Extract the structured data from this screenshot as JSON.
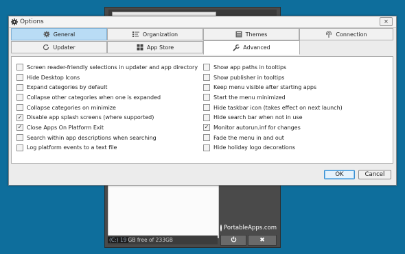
{
  "dialog": {
    "title": "Options",
    "close_label": "✕",
    "tabs": [
      {
        "label": "General",
        "icon": "gear-icon",
        "state": "highlighted"
      },
      {
        "label": "Organization",
        "icon": "list-icon",
        "state": "normal"
      },
      {
        "label": "Themes",
        "icon": "themes-icon",
        "state": "normal"
      },
      {
        "label": "Connection",
        "icon": "antenna-icon",
        "state": "normal"
      },
      {
        "label": "Updater",
        "icon": "refresh-icon",
        "state": "normal"
      },
      {
        "label": "App Store",
        "icon": "grid-icon",
        "state": "normal"
      },
      {
        "label": "Advanced",
        "icon": "wrench-icon",
        "state": "active"
      }
    ],
    "left_options": [
      {
        "label": "Screen reader-friendly selections in updater and app directory",
        "checked": false
      },
      {
        "label": "Hide Desktop Icons",
        "checked": false
      },
      {
        "label": "Expand categories by default",
        "checked": false
      },
      {
        "label": "Collapse other categories when one is expanded",
        "checked": false
      },
      {
        "label": "Collapse categories on minimize",
        "checked": false
      },
      {
        "label": "Disable app splash screens (where supported)",
        "checked": true
      },
      {
        "label": "Close Apps On Platform Exit",
        "checked": true
      },
      {
        "label": "Search within app descriptions when searching",
        "checked": false
      },
      {
        "label": "Log platform events to a text file",
        "checked": false
      }
    ],
    "right_options": [
      {
        "label": "Show app paths in tooltips",
        "checked": false
      },
      {
        "label": "Show publisher in tooltips",
        "checked": false
      },
      {
        "label": "Keep menu visible after starting apps",
        "checked": false
      },
      {
        "label": "Start the menu minimized",
        "checked": false
      },
      {
        "label": "Hide taskbar icon (takes effect on next launch)",
        "checked": false
      },
      {
        "label": "Hide search bar when not in use",
        "checked": false
      },
      {
        "label": "Monitor autorun.inf for changes",
        "checked": true
      },
      {
        "label": "Fade the menu in and out",
        "checked": false
      },
      {
        "label": "Hide holiday logo decorations",
        "checked": false
      }
    ],
    "ok_label": "OK",
    "cancel_label": "Cancel"
  },
  "background_menu": {
    "logo_text": "PortableApps.com",
    "drive_prefix": "(C:) 19",
    "drive_rest": "GB free of 233GB",
    "power_icon": "power-icon",
    "close_icon_label": "✖"
  },
  "colors": {
    "desktop": "#0e6e9c",
    "tab_highlight": "#b9dcf5",
    "ok_focus": "#3a8fd0"
  }
}
